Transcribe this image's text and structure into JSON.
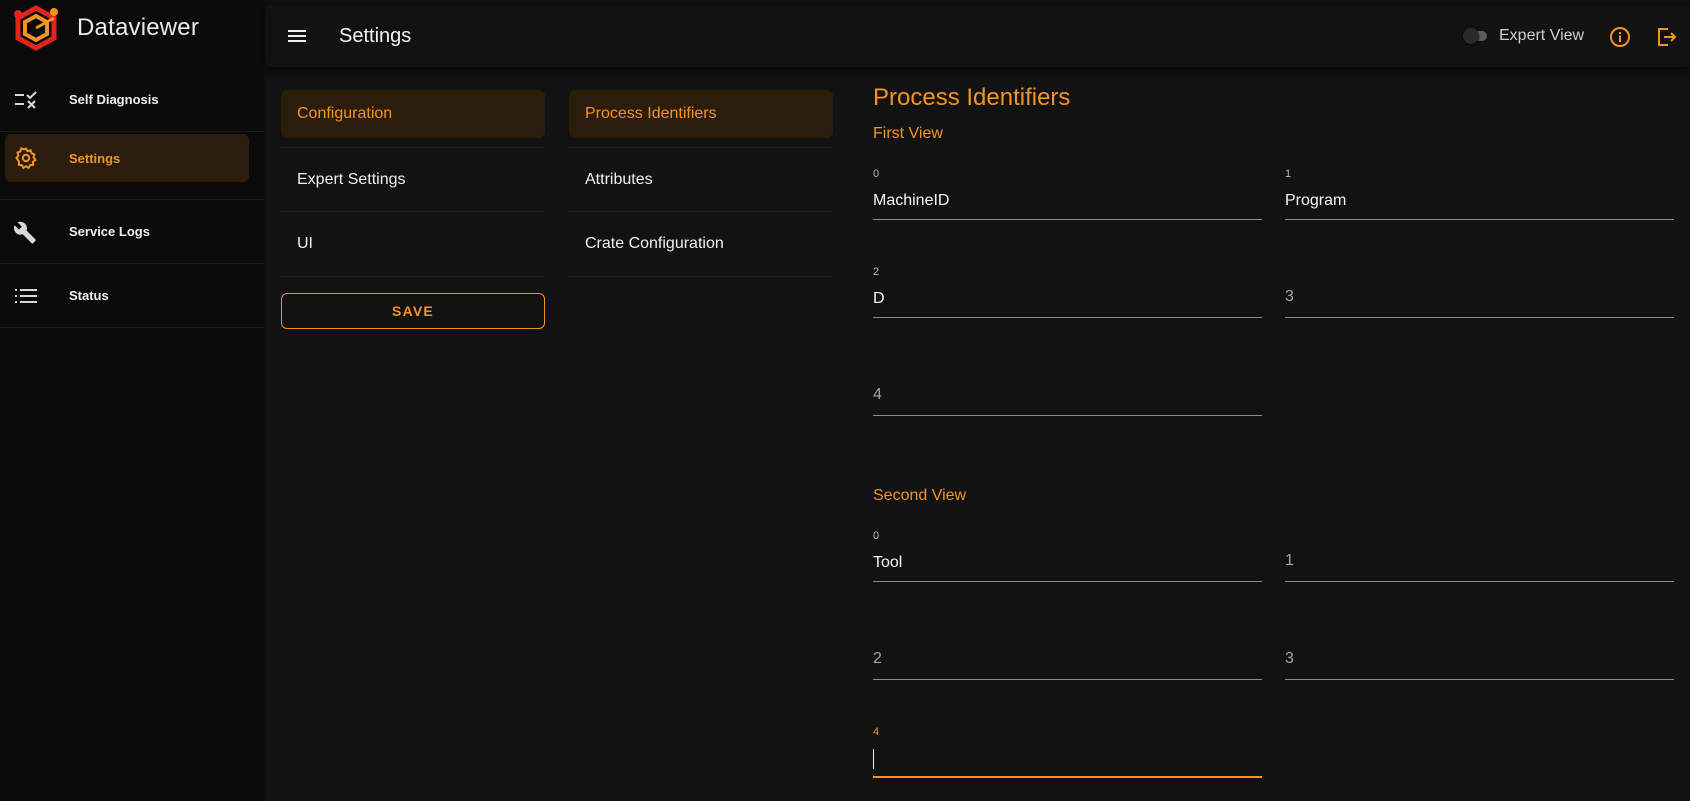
{
  "app": {
    "name": "Dataviewer",
    "brand_colors": {
      "accent": "#f39322",
      "logo_red": "#e2241c"
    }
  },
  "sidebar": {
    "items": [
      {
        "label": "Self Diagnosis",
        "icon": "checklist-x-icon"
      },
      {
        "label": "Settings",
        "icon": "gear-icon",
        "active": true
      },
      {
        "label": "Service Logs",
        "icon": "wrench-icon"
      },
      {
        "label": "Status",
        "icon": "list-icon"
      }
    ]
  },
  "header": {
    "title": "Settings",
    "expert_view_label": "Expert View",
    "expert_view_on": false
  },
  "settings_menu": {
    "items": [
      "Configuration",
      "Expert Settings",
      "UI"
    ],
    "selected": "Configuration",
    "save_label": "SAVE"
  },
  "config_menu": {
    "items": [
      "Process Identifiers",
      "Attributes",
      "Crate Configuration"
    ],
    "selected": "Process Identifiers"
  },
  "form": {
    "title": "Process Identifiers",
    "first_view": {
      "title": "First View",
      "fields": [
        {
          "label": "0",
          "value": "MachineID"
        },
        {
          "label": "1",
          "value": "Program"
        },
        {
          "label": "2",
          "value": "D"
        },
        {
          "label": "3",
          "value": ""
        },
        {
          "label": "4",
          "value": ""
        }
      ]
    },
    "second_view": {
      "title": "Second View",
      "fields": [
        {
          "label": "0",
          "value": "Tool"
        },
        {
          "label": "1",
          "value": ""
        },
        {
          "label": "2",
          "value": ""
        },
        {
          "label": "3",
          "value": ""
        },
        {
          "label": "4",
          "value": "",
          "focused": true
        }
      ]
    }
  }
}
